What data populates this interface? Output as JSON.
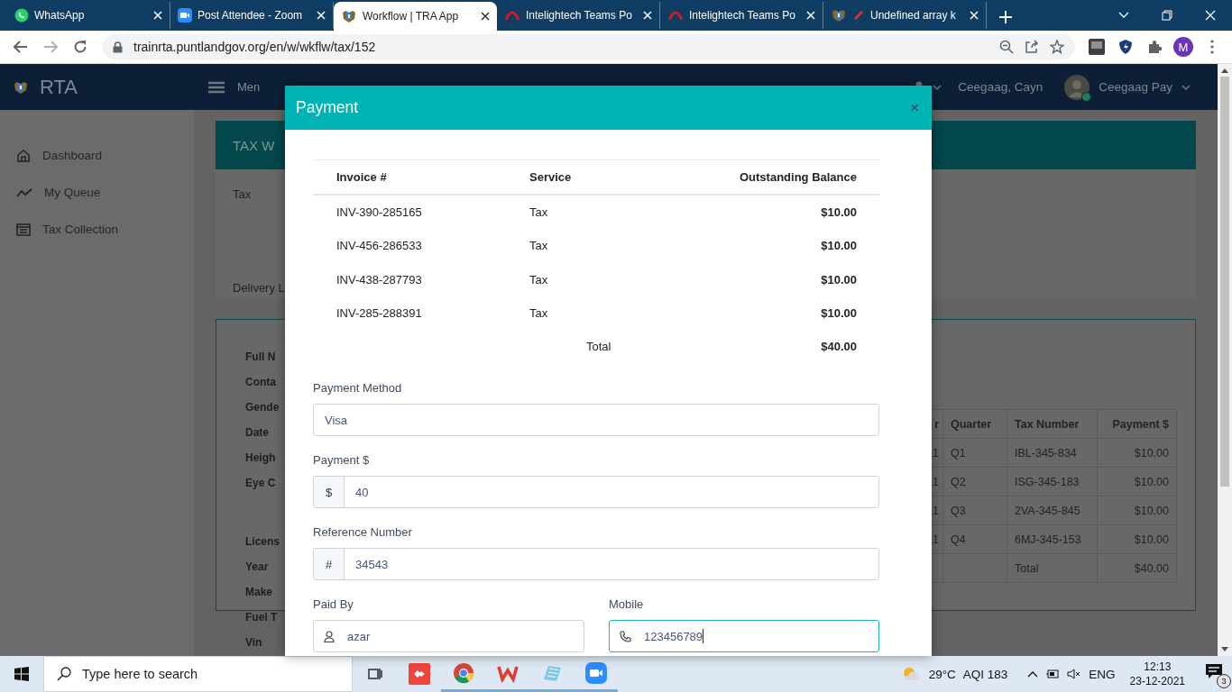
{
  "browser": {
    "tabs": [
      {
        "title": "WhatsApp",
        "selected": false
      },
      {
        "title": "Post Attendee - Zoom",
        "selected": false
      },
      {
        "title": "Workflow | TRA App",
        "selected": true
      },
      {
        "title": "Intelightech Teams Po",
        "selected": false
      },
      {
        "title": "Intelightech Teams Po",
        "selected": false
      },
      {
        "title": "Undefined array k",
        "selected": false
      }
    ],
    "url": "trainrta.puntlandgov.org/en/w/wkflw/tax/152",
    "profile": "M"
  },
  "app": {
    "brand": "RTA",
    "menu": "Men",
    "account": "Ceegaag, Cayn",
    "user": "Ceegaag Pay",
    "sidebar": [
      {
        "label": "Dashboard"
      },
      {
        "label": "My Queue"
      },
      {
        "label": "Tax Collection"
      }
    ]
  },
  "background": {
    "card_title": "TAX W",
    "tax_label": "Tax",
    "delivery_label": "Delivery L",
    "detail_groups": [
      [
        "Full N",
        "Conta",
        "Gende",
        "Date",
        "Heigh",
        "Eye C"
      ],
      [
        "Licens",
        "Year",
        "Make",
        "Fuel T",
        "Vin"
      ]
    ],
    "tax_table": {
      "columns": [
        "r",
        "Quarter",
        "Tax Number",
        "Payment $"
      ],
      "rows": [
        [
          "1",
          "Q1",
          "IBL-345-834",
          "$10.00"
        ],
        [
          "1",
          "Q2",
          "ISG-345-183",
          "$10.00"
        ],
        [
          "1",
          "Q3",
          "2VA-345-845",
          "$10.00"
        ],
        [
          "1",
          "Q4",
          "6MJ-345-153",
          "$10.00"
        ],
        [
          "",
          "",
          "Total",
          "$40.00"
        ]
      ]
    }
  },
  "modal": {
    "title": "Payment",
    "close": "×",
    "invoice_table": {
      "columns": [
        "Invoice #",
        "Service",
        "Outstanding Balance"
      ],
      "rows": [
        {
          "invoice": "INV-390-285165",
          "service": "Tax",
          "balance": "$10.00"
        },
        {
          "invoice": "INV-456-286533",
          "service": "Tax",
          "balance": "$10.00"
        },
        {
          "invoice": "INV-438-287793",
          "service": "Tax",
          "balance": "$10.00"
        },
        {
          "invoice": "INV-285-288391",
          "service": "Tax",
          "balance": "$10.00"
        }
      ],
      "total_label": "Total",
      "total": "$40.00"
    },
    "fields": [
      {
        "kind": "select",
        "label": "Payment Method",
        "value": "Visa",
        "focused": false
      },
      {
        "kind": "prefix",
        "label": "Payment $",
        "prefix": "$",
        "value": "40",
        "focused": false
      },
      {
        "kind": "prefix",
        "label": "Reference Number",
        "prefix": "#",
        "value": "34543",
        "focused": false
      }
    ],
    "contact_fields": [
      {
        "kind": "person",
        "label": "Paid By",
        "value": "azar",
        "focused": false
      },
      {
        "kind": "phone",
        "label": "Mobile",
        "value": "123456789",
        "focused": true
      }
    ]
  },
  "taskbar": {
    "search_placeholder": "Type here to search",
    "temperature": "29°C",
    "aqi": "AQI 183",
    "language": "ENG",
    "time": "12:13",
    "date": "23-12-2021",
    "notifications": "3"
  }
}
